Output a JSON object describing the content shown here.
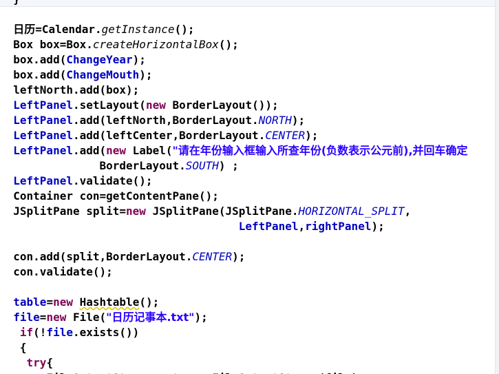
{
  "editor": {
    "lines": [
      [
        {
          "t": "  }"
        }
      ],
      [],
      [
        {
          "t": "  "
        },
        {
          "t": "日历",
          "k": "cjk"
        },
        {
          "t": "=Calendar."
        },
        {
          "t": "getInstance",
          "k": "italic"
        },
        {
          "t": "();"
        }
      ],
      [
        {
          "t": "  Box box=Box."
        },
        {
          "t": "createHorizontalBox",
          "k": "italic"
        },
        {
          "t": "();"
        }
      ],
      [
        {
          "t": "  box.add("
        },
        {
          "t": "ChangeYear",
          "k": "field"
        },
        {
          "t": ");"
        }
      ],
      [
        {
          "t": "  box.add("
        },
        {
          "t": "ChangeMouth",
          "k": "field"
        },
        {
          "t": ");"
        }
      ],
      [
        {
          "t": "  leftNorth.add(box);"
        }
      ],
      [
        {
          "t": "  "
        },
        {
          "t": "LeftPanel",
          "k": "field"
        },
        {
          "t": ".setLayout("
        },
        {
          "t": "new",
          "k": "kw"
        },
        {
          "t": " BorderLayout());"
        }
      ],
      [
        {
          "t": "  "
        },
        {
          "t": "LeftPanel",
          "k": "field"
        },
        {
          "t": ".add(leftNorth,BorderLayout."
        },
        {
          "t": "NORTH",
          "k": "static"
        },
        {
          "t": ");"
        }
      ],
      [
        {
          "t": "  "
        },
        {
          "t": "LeftPanel",
          "k": "field"
        },
        {
          "t": ".add(leftCenter,BorderLayout."
        },
        {
          "t": "CENTER",
          "k": "static"
        },
        {
          "t": ");"
        }
      ],
      [
        {
          "t": "  "
        },
        {
          "t": "LeftPanel",
          "k": "field"
        },
        {
          "t": ".add("
        },
        {
          "t": "new",
          "k": "kw"
        },
        {
          "t": " Label("
        },
        {
          "t": "\"请在年份输入框输入所查年份(负数表示公元前),并回车确定",
          "k": "str"
        }
      ],
      [
        {
          "t": "               BorderLayout."
        },
        {
          "t": "SOUTH",
          "k": "static"
        },
        {
          "t": ") ;"
        }
      ],
      [
        {
          "t": "  "
        },
        {
          "t": "LeftPanel",
          "k": "field"
        },
        {
          "t": ".validate();"
        }
      ],
      [
        {
          "t": "  Container con=getContentPane();"
        }
      ],
      [
        {
          "t": "  JSplitPane split="
        },
        {
          "t": "new",
          "k": "kw"
        },
        {
          "t": " JSplitPane(JSplitPane."
        },
        {
          "t": "HORIZONTAL_SPLIT",
          "k": "static"
        },
        {
          "t": ","
        }
      ],
      [
        {
          "t": "                                    "
        },
        {
          "t": "LeftPanel",
          "k": "field"
        },
        {
          "t": ","
        },
        {
          "t": "rightPanel",
          "k": "field"
        },
        {
          "t": ");"
        }
      ],
      [],
      [
        {
          "t": "  con.add(split,BorderLayout."
        },
        {
          "t": "CENTER",
          "k": "static"
        },
        {
          "t": ");"
        }
      ],
      [
        {
          "t": "  con.validate();"
        }
      ],
      [],
      [
        {
          "t": "  "
        },
        {
          "t": "table",
          "k": "field"
        },
        {
          "t": "="
        },
        {
          "t": "new",
          "k": "kw"
        },
        {
          "t": " "
        },
        {
          "t": "Hashtable",
          "k": "warn"
        },
        {
          "t": "();"
        }
      ],
      [
        {
          "t": "  "
        },
        {
          "t": "file",
          "k": "field"
        },
        {
          "t": "="
        },
        {
          "t": "new",
          "k": "kw"
        },
        {
          "t": " File("
        },
        {
          "t": "\"日历记事本.txt\"",
          "k": "str"
        },
        {
          "t": ");"
        }
      ],
      [
        {
          "t": "   "
        },
        {
          "t": "if",
          "k": "kw"
        },
        {
          "t": "(!"
        },
        {
          "t": "file",
          "k": "field"
        },
        {
          "t": ".exists())"
        }
      ],
      [
        {
          "t": "   {"
        }
      ],
      [
        {
          "t": "    "
        },
        {
          "t": "try",
          "k": "kw"
        },
        {
          "t": "{"
        }
      ],
      [
        {
          "t": "       FileOutputStream out=new FileOutputStream(file);"
        }
      ]
    ]
  },
  "colors": {
    "field": "#0000c0",
    "keyword": "#7f0055",
    "string": "#2a00ff",
    "text": "#000000",
    "warning_underline": "#e2c400"
  }
}
